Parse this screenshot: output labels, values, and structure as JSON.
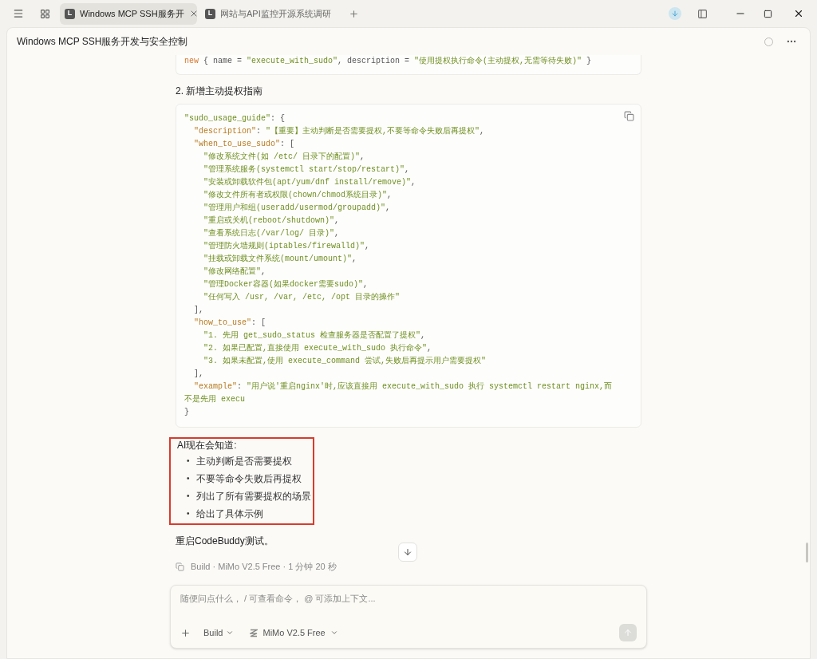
{
  "tabs": [
    {
      "badge": "L",
      "label": "Windows MCP SSH服务开",
      "selected": true
    },
    {
      "badge": "L",
      "label": "网站与API监控开源系统调研",
      "selected": false
    }
  ],
  "header": {
    "title": "Windows MCP SSH服务开发与安全控制"
  },
  "messages": [
    {
      "kind": "code",
      "lines": [
        [
          {
            "kind": "kw",
            "text": "new"
          },
          {
            "kind": "punct",
            "text": " { name = "
          },
          {
            "kind": "str",
            "text": "\"execute_with_sudo\""
          },
          {
            "kind": "punct",
            "text": ", description = "
          },
          {
            "kind": "str",
            "text": "\"使用提权执行命令(主动提权,无需等待失败)\""
          },
          {
            "kind": "punct",
            "text": " }"
          }
        ]
      ]
    },
    {
      "kind": "paragraph",
      "text": "2. 新增主动提权指南"
    },
    {
      "kind": "code",
      "copyable": true,
      "lines": [
        [
          {
            "kind": "str",
            "text": "\"sudo_usage_guide\""
          },
          {
            "kind": "punct",
            "text": ": {"
          }
        ],
        [
          {
            "kind": "key",
            "text": "  \"description\""
          },
          {
            "kind": "punct",
            "text": ": "
          },
          {
            "kind": "str",
            "text": "\"【重要】主动判断是否需要提权,不要等命令失败后再提权\""
          },
          {
            "kind": "punct",
            "text": ","
          }
        ],
        [
          {
            "kind": "key",
            "text": "  \"when_to_use_sudo\""
          },
          {
            "kind": "punct",
            "text": ": ["
          }
        ],
        [
          {
            "kind": "str",
            "text": "    \"修改系统文件(如 /etc/ 目录下的配置)\""
          },
          {
            "kind": "punct",
            "text": ","
          }
        ],
        [
          {
            "kind": "str",
            "text": "    \"管理系统服务(systemctl start/stop/restart)\""
          },
          {
            "kind": "punct",
            "text": ","
          }
        ],
        [
          {
            "kind": "str",
            "text": "    \"安装或卸载软件包(apt/yum/dnf install/remove)\""
          },
          {
            "kind": "punct",
            "text": ","
          }
        ],
        [
          {
            "kind": "str",
            "text": "    \"修改文件所有者或权限(chown/chmod系统目录)\""
          },
          {
            "kind": "punct",
            "text": ","
          }
        ],
        [
          {
            "kind": "str",
            "text": "    \"管理用户和组(useradd/usermod/groupadd)\""
          },
          {
            "kind": "punct",
            "text": ","
          }
        ],
        [
          {
            "kind": "str",
            "text": "    \"重启或关机(reboot/shutdown)\""
          },
          {
            "kind": "punct",
            "text": ","
          }
        ],
        [
          {
            "kind": "str",
            "text": "    \"查看系统日志(/var/log/ 目录)\""
          },
          {
            "kind": "punct",
            "text": ","
          }
        ],
        [
          {
            "kind": "str",
            "text": "    \"管理防火墙规则(iptables/firewalld)\""
          },
          {
            "kind": "punct",
            "text": ","
          }
        ],
        [
          {
            "kind": "str",
            "text": "    \"挂载或卸载文件系统(mount/umount)\""
          },
          {
            "kind": "punct",
            "text": ","
          }
        ],
        [
          {
            "kind": "str",
            "text": "    \"修改网络配置\""
          },
          {
            "kind": "punct",
            "text": ","
          }
        ],
        [
          {
            "kind": "str",
            "text": "    \"管理Docker容器(如果docker需要sudo)\""
          },
          {
            "kind": "punct",
            "text": ","
          }
        ],
        [
          {
            "kind": "str",
            "text": "    \"任何写入 /usr, /var, /etc, /opt 目录的操作\""
          }
        ],
        [
          {
            "kind": "punct",
            "text": "  ],"
          }
        ],
        [
          {
            "kind": "key",
            "text": "  \"how_to_use\""
          },
          {
            "kind": "punct",
            "text": ": ["
          }
        ],
        [
          {
            "kind": "str",
            "text": "    \"1. 先用 get_sudo_status 检查服务器是否配置了提权\""
          },
          {
            "kind": "punct",
            "text": ","
          }
        ],
        [
          {
            "kind": "str",
            "text": "    \"2. 如果已配置,直接使用 execute_with_sudo 执行命令\""
          },
          {
            "kind": "punct",
            "text": ","
          }
        ],
        [
          {
            "kind": "str",
            "text": "    \"3. 如果未配置,使用 execute_command 尝试,失败后再提示用户需要提权\""
          }
        ],
        [
          {
            "kind": "punct",
            "text": "  ],"
          }
        ],
        [
          {
            "kind": "key",
            "text": "  \"example\""
          },
          {
            "kind": "punct",
            "text": ": "
          },
          {
            "kind": "str",
            "text": "\"用户说'重启nginx'时,应该直接用 execute_with_sudo 执行 systemctl restart nginx,而不是先用 execu"
          }
        ],
        [
          {
            "kind": "punct",
            "text": "}"
          }
        ]
      ]
    },
    {
      "kind": "list",
      "highlighted": true,
      "title": "AI现在会知道:",
      "marker": "•",
      "items": [
        "主动判断是否需要提权",
        "不要等命令失败后再提权",
        "列出了所有需要提权的场景",
        "给出了具体示例"
      ]
    },
    {
      "kind": "paragraph",
      "text": "重启CodeBuddy测试。"
    },
    {
      "kind": "meta",
      "text": "Build · MiMo V2.5 Free · 1 分钟 20 秒"
    }
  ],
  "composer": {
    "placeholder": "随便问点什么， / 可查看命令， @ 可添加上下文...",
    "mode": "Build",
    "model": "MiMo V2.5 Free"
  }
}
